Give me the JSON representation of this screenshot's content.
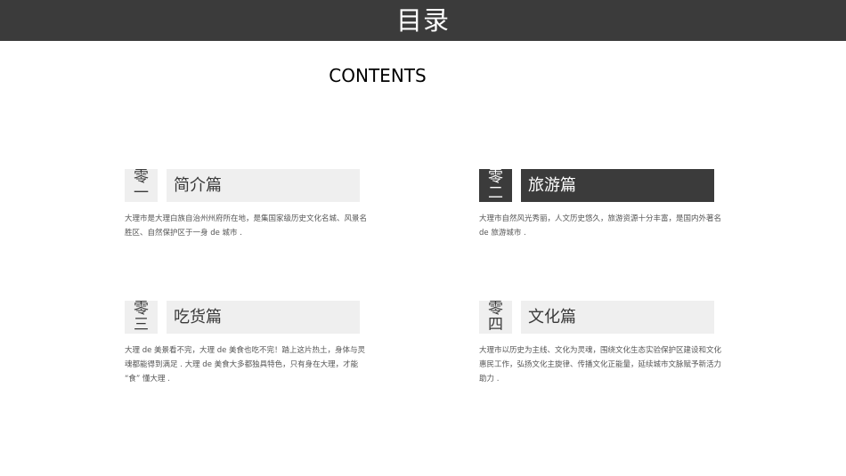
{
  "header": {
    "title": "目录"
  },
  "subtitle": "CONTENTS",
  "sections": [
    {
      "num_top": "零",
      "num_bottom": "一",
      "title": "简介篇",
      "desc": "大理市是大理白族自治州州府所在地，是集国家级历史文化名城、风景名胜区、自然保护区于一身 de 城市 ."
    },
    {
      "num_top": "零",
      "num_bottom": "二",
      "title": "旅游篇",
      "desc": "大理市自然风光秀丽，人文历史悠久，旅游资源十分丰富，是国内外著名 de 旅游城市 ."
    },
    {
      "num_top": "零",
      "num_bottom": "三",
      "title": "吃货篇",
      "desc": "大理 de 美景看不完，大理 de 美食也吃不完！踏上这片热土，身体与灵魂都能得到满足 . 大理 de 美食大多都独具特色，只有身在大理，才能 “食” 懂大理 ."
    },
    {
      "num_top": "零",
      "num_bottom": "四",
      "title": "文化篇",
      "desc": "大理市以历史为主线、文化为灵魂，围绕文化生态实验保护区建设和文化惠民工作，弘扬文化主旋律、传播文化正能量，延续城市文脉赋予新活力助力 ."
    }
  ],
  "colors": {
    "header_bg": "#3b3b3b",
    "box_light": "#efefef",
    "box_dark": "#3b3b3b",
    "text": "#3a3a3a"
  }
}
